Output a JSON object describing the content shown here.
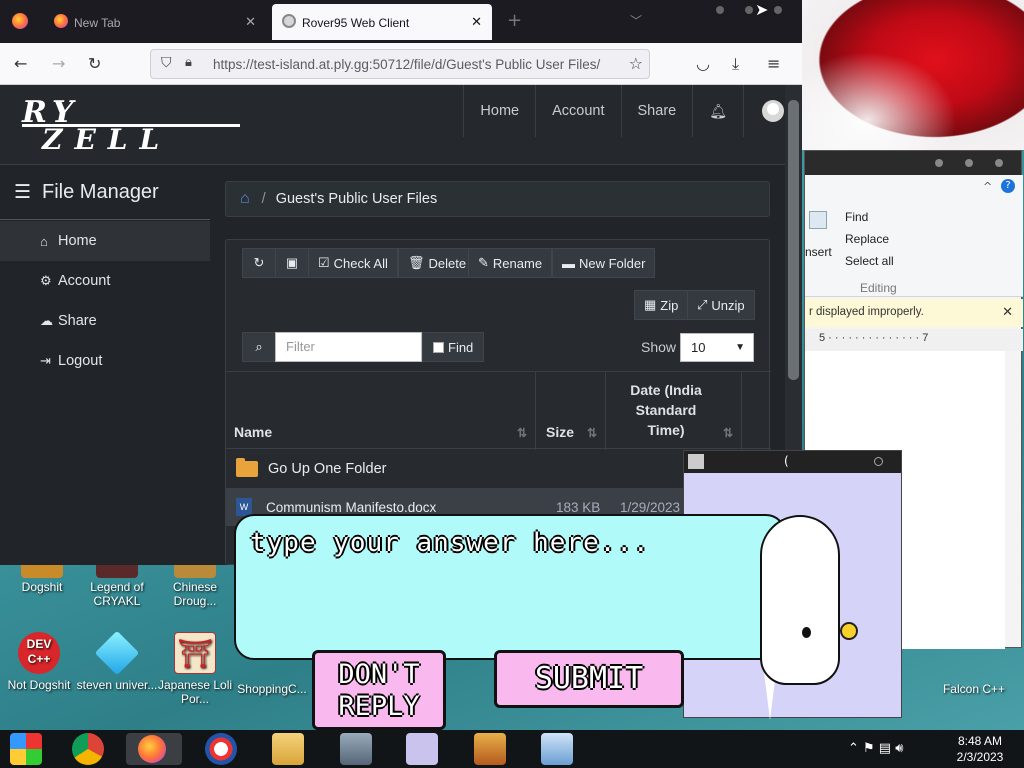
{
  "browser": {
    "tabs": [
      {
        "label": "New Tab",
        "active": false
      },
      {
        "label": "Rover95 Web Client",
        "active": true
      }
    ],
    "new_tab_glyph": "+",
    "url": "https://test-island.at.ply.gg:50712/file/d/Guest's Public User Files/"
  },
  "site": {
    "logo_line1": "RY",
    "logo_line2": "ZELL",
    "topnav": [
      "Home",
      "Account",
      "Share"
    ],
    "sidebar_title": "File Manager",
    "sidebar_items": [
      "Home",
      "Account",
      "Share",
      "Logout"
    ],
    "breadcrumb": "Guest's Public User Files"
  },
  "toolbar": {
    "check_all": "Check All",
    "delete": "Delete",
    "rename": "Rename",
    "new_folder": "New Folder",
    "zip": "Zip",
    "unzip": "Unzip",
    "filter_placeholder": "Filter",
    "find": "Find",
    "show_label": "Show",
    "show_value": "10"
  },
  "table": {
    "headers": [
      "Name",
      "Size",
      "Date (India Standard Time)"
    ],
    "rows": [
      {
        "name": "Go Up One Folder",
        "size": "",
        "date": ""
      },
      {
        "name": "Communism Manifesto.docx",
        "size": "183 KB",
        "date": "1/29/2023"
      }
    ]
  },
  "wordpad": {
    "find": "Find",
    "replace": "Replace",
    "select_all": "Select all",
    "editing": "Editing",
    "insert": "nsert",
    "notice": "r displayed improperly.",
    "ruler": "5 · · · · · · · · · · · · · · 7"
  },
  "overlay": {
    "answer_placeholder": "type your answer here...",
    "dont_reply": "DON'T REPLY",
    "submit": "SUBMIT"
  },
  "desktop_icons": [
    {
      "label": "Dogshit"
    },
    {
      "label": "Legend of CRYAKL"
    },
    {
      "label": "Chinese Droug..."
    },
    {
      "label": "Not Dogshit"
    },
    {
      "label": "steven univer..."
    },
    {
      "label": "Japanese Loli Por..."
    },
    {
      "label": "ShoppingC..."
    },
    {
      "label": "Falcon C++"
    }
  ],
  "tray": {
    "time": "8:48 AM",
    "date": "2/3/2023"
  },
  "colors": {
    "accent_home": "#4a90d9",
    "bubble": "#b0fbfa",
    "button_pink": "#f9b9ee"
  }
}
